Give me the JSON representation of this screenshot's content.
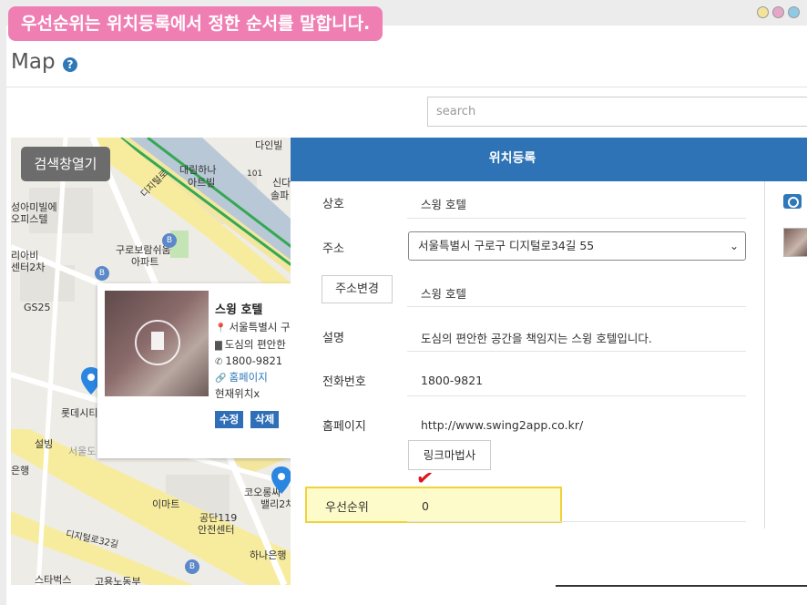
{
  "banner": "우선순위는 위치등록에서 정한 순서를 말합니다.",
  "page": {
    "title": "Map",
    "help_icon": "question-circle-icon"
  },
  "search": {
    "placeholder": "search"
  },
  "map": {
    "open_search_button": "검색창열기",
    "labels": [
      "다인빌",
      "대림하나",
      "아트빌",
      "101",
      "신다",
      "솔파",
      "성아미빌에",
      "오피스텔",
      "디지털로",
      "구로보람쉬움",
      "아파트",
      "리아비",
      "센터2차",
      "GS25",
      "롯데시티",
      "설빙",
      "서울도",
      "은행",
      "이마트",
      "공단119",
      "안전센터",
      "코오롱싸",
      "밸리2차",
      "디지털로32길",
      "하나은행",
      "스타벅스",
      "고용노동부"
    ]
  },
  "info_card": {
    "name": "스윙 호텔",
    "address": "서울특별시 구로구",
    "description": "도심의 편안한",
    "phone": "1800-9821",
    "homepage": "홈페이지",
    "location": "현재위치x",
    "edit_button": "수정",
    "delete_button": "삭제"
  },
  "panel": {
    "title": "위치등록",
    "fields": {
      "name_label": "상호",
      "name_value": "스윙 호텔",
      "address_label": "주소",
      "address_value": "서울특별시 구로구 디지털로34길 55",
      "change_address_button": "주소변경",
      "address_detail": "스윙 호텔",
      "description_label": "설명",
      "description_value": "도심의 편안한 공간을 책임지는 스윙 호텔입니다.",
      "phone_label": "전화번호",
      "phone_value": "1800-9821",
      "homepage_label": "홈페이지",
      "homepage_value": "http://www.swing2app.co.kr/",
      "link_wizard_button": "링크마법사",
      "priority_label": "우선순위",
      "priority_value": "0"
    },
    "icons": {
      "camera": "camera-icon",
      "check": "check-mark-icon"
    }
  },
  "colors": {
    "banner": "#ef7fb3",
    "header_blue": "#2e73b5",
    "highlight_fill": "#fdfbc9",
    "highlight_border": "#f0d23c",
    "check": "#e0121d"
  }
}
